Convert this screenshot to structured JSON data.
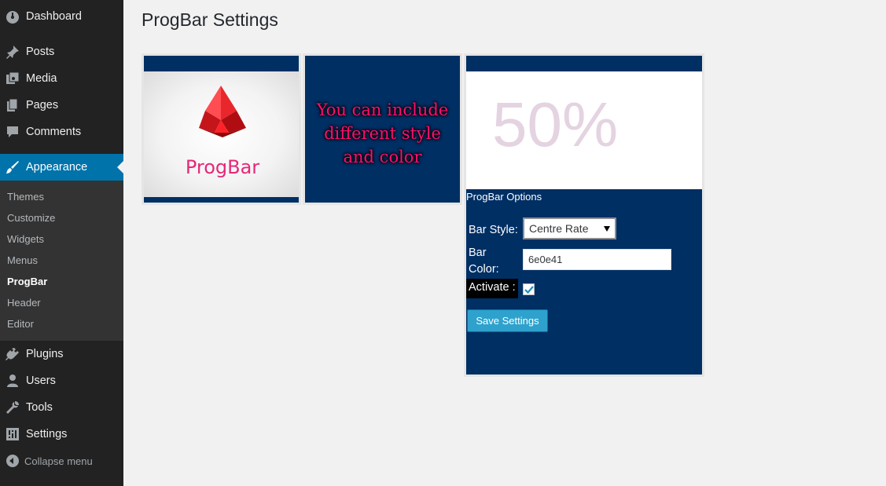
{
  "page": {
    "title": "ProgBar Settings"
  },
  "sidebar": {
    "items": [
      {
        "label": "Dashboard",
        "icon": "dashboard-icon"
      },
      {
        "label": "Posts",
        "icon": "pin-icon"
      },
      {
        "label": "Media",
        "icon": "media-icon"
      },
      {
        "label": "Pages",
        "icon": "pages-icon"
      },
      {
        "label": "Comments",
        "icon": "comment-icon"
      },
      {
        "label": "Appearance",
        "icon": "brush-icon",
        "active": true
      },
      {
        "label": "Plugins",
        "icon": "plugin-icon"
      },
      {
        "label": "Users",
        "icon": "user-icon"
      },
      {
        "label": "Tools",
        "icon": "wrench-icon"
      },
      {
        "label": "Settings",
        "icon": "settings-icon"
      }
    ],
    "submenu": [
      "Themes",
      "Customize",
      "Widgets",
      "Menus",
      "ProgBar",
      "Header",
      "Editor"
    ],
    "submenu_current": "ProgBar",
    "collapse_label": "Collapse menu"
  },
  "panels": {
    "logo_text": "ProgBar",
    "promo_lines": [
      "You can include",
      "different style",
      "and color"
    ],
    "percent_text": "50%"
  },
  "options": {
    "title": "ProgBar Options",
    "bar_style_label": "Bar Style:",
    "bar_style_value": "Centre Rate",
    "bar_color_label_line1": "Bar",
    "bar_color_label_line2": "Color:",
    "bar_color_value": "6e0e41",
    "activate_label": "Activate :",
    "activate_checked": true,
    "save_label": "Save Settings"
  },
  "colors": {
    "sidebar_bg": "#222222",
    "submenu_bg": "#333333",
    "accent": "#0073aa",
    "panel_bg": "#002f64",
    "button_bg": "#2ea2cc",
    "promo_text": "#ff0f6e",
    "percent_text": "#e4d3e0"
  }
}
